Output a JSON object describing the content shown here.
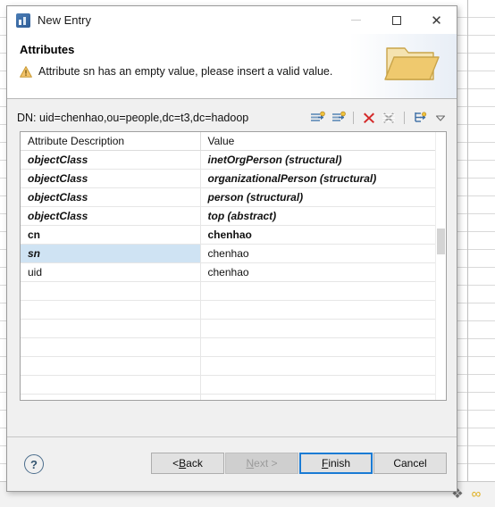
{
  "window": {
    "title": "New Entry",
    "app_icon": "ldap-browser-icon",
    "controls": {
      "minimize": "–",
      "maximize": "□",
      "close": "✕"
    }
  },
  "banner": {
    "heading": "Attributes",
    "message": "Attribute sn has an empty value, please insert a valid value.",
    "message_icon": "warning-icon",
    "decoration_icon": "folder-icon"
  },
  "dn": {
    "label": "DN: uid=chenhao,ou=people,dc=t3,dc=hadoop",
    "tools": [
      {
        "name": "new-attribute-icon",
        "title": "New Attribute"
      },
      {
        "name": "new-value-icon",
        "title": "New Value"
      },
      {
        "name": "delete-icon",
        "title": "Delete"
      },
      {
        "name": "delete-all-icon",
        "title": "Delete All"
      },
      {
        "name": "expand-all-icon",
        "title": "Expand All"
      },
      {
        "name": "view-menu-chevron-icon",
        "title": "View Menu"
      }
    ]
  },
  "table": {
    "columns": [
      "Attribute Description",
      "Value"
    ],
    "rows": [
      {
        "attribute": "objectClass",
        "value": "inetOrgPerson (structural)",
        "style": "must",
        "selected": false
      },
      {
        "attribute": "objectClass",
        "value": "organizationalPerson (structural)",
        "style": "must",
        "selected": false
      },
      {
        "attribute": "objectClass",
        "value": "person (structural)",
        "style": "must",
        "selected": false
      },
      {
        "attribute": "objectClass",
        "value": "top (abstract)",
        "style": "must",
        "selected": false
      },
      {
        "attribute": "cn",
        "value": "chenhao",
        "style": "bold-plain",
        "selected": false
      },
      {
        "attribute": "sn",
        "value": "chenhao",
        "style": "plain",
        "selected": true
      },
      {
        "attribute": "uid",
        "value": "chenhao",
        "style": "plain",
        "selected": false
      },
      {
        "attribute": "",
        "value": "",
        "style": "plain",
        "selected": false
      },
      {
        "attribute": "",
        "value": "",
        "style": "plain",
        "selected": false
      },
      {
        "attribute": "",
        "value": "",
        "style": "plain",
        "selected": false
      },
      {
        "attribute": "",
        "value": "",
        "style": "plain",
        "selected": false
      },
      {
        "attribute": "",
        "value": "",
        "style": "plain",
        "selected": false
      },
      {
        "attribute": "",
        "value": "",
        "style": "plain",
        "selected": false
      },
      {
        "attribute": "",
        "value": "",
        "style": "plain",
        "selected": false
      }
    ]
  },
  "footer": {
    "help": "?",
    "buttons": [
      {
        "name": "back-button",
        "label": "< Back",
        "mnemonic": "B",
        "state": "enabled"
      },
      {
        "name": "next-button",
        "label": "Next >",
        "mnemonic": "N",
        "state": "disabled"
      },
      {
        "name": "finish-button",
        "label": "Finish",
        "mnemonic": "F",
        "state": "default"
      },
      {
        "name": "cancel-button",
        "label": "Cancel",
        "mnemonic": "",
        "state": "enabled"
      }
    ]
  },
  "tray": {
    "icons": [
      {
        "name": "puzzle-piece-icon",
        "glyph": "❖"
      },
      {
        "name": "link-icon",
        "glyph": "∞"
      }
    ]
  },
  "colors": {
    "selection": "#cfe3f3",
    "default_button_border": "#1a7bd4",
    "warning": "#e8a33d",
    "delete_red": "#d42a2a",
    "folder": "#e9c66a"
  }
}
